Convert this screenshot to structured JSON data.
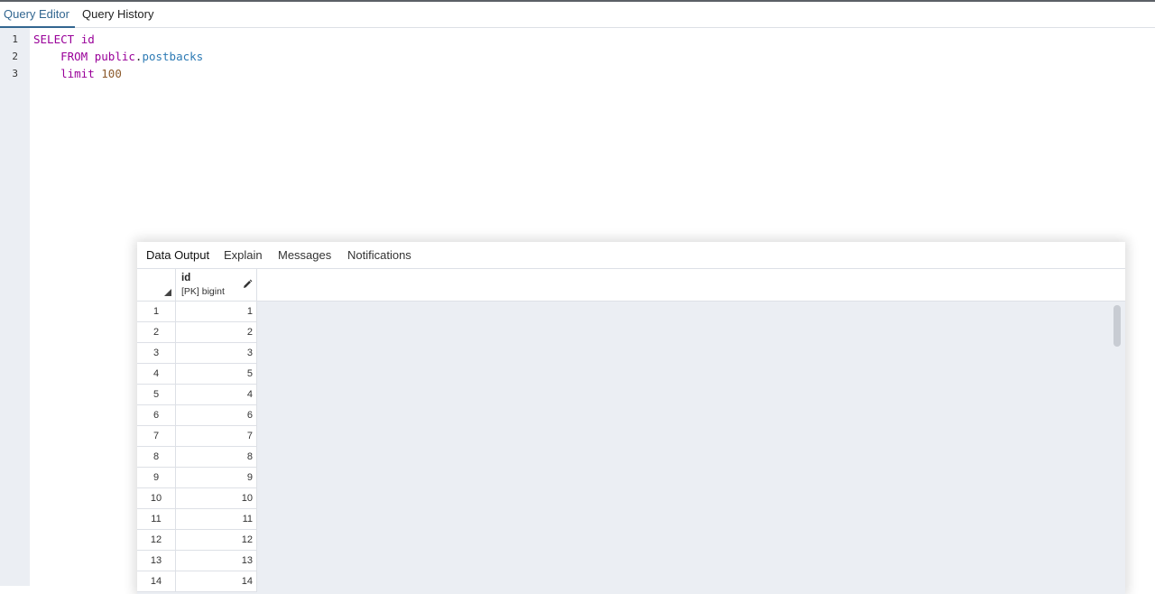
{
  "editor_tabs": [
    {
      "label": "Query Editor",
      "active": true
    },
    {
      "label": "Query History",
      "active": false
    }
  ],
  "line_numbers": [
    "1",
    "2",
    "3"
  ],
  "code": {
    "line1": {
      "kw": "SELECT",
      "ident": "id"
    },
    "line2": {
      "kw": "FROM",
      "schema": "public",
      "dot": ".",
      "table": "postbacks"
    },
    "line3": {
      "kw": "limit",
      "num": "100"
    }
  },
  "output_tabs": [
    {
      "label": "Data Output",
      "active": true
    },
    {
      "label": "Explain",
      "active": false
    },
    {
      "label": "Messages",
      "active": false
    },
    {
      "label": "Notifications",
      "active": false
    }
  ],
  "grid": {
    "column": {
      "name": "id",
      "type": "[PK] bigint"
    },
    "rows": [
      {
        "n": "1",
        "v": "1"
      },
      {
        "n": "2",
        "v": "2"
      },
      {
        "n": "3",
        "v": "3"
      },
      {
        "n": "4",
        "v": "5"
      },
      {
        "n": "5",
        "v": "4"
      },
      {
        "n": "6",
        "v": "6"
      },
      {
        "n": "7",
        "v": "7"
      },
      {
        "n": "8",
        "v": "8"
      },
      {
        "n": "9",
        "v": "9"
      },
      {
        "n": "10",
        "v": "10"
      },
      {
        "n": "11",
        "v": "11"
      },
      {
        "n": "12",
        "v": "12"
      },
      {
        "n": "13",
        "v": "13"
      },
      {
        "n": "14",
        "v": "14"
      }
    ]
  },
  "colors": {
    "accent": "#326690",
    "keyword": "#990099",
    "table": "#2e7bb5",
    "number": "#8c5a2b",
    "grid_bg": "#ebeef3"
  },
  "icons": {
    "edit_column": "pencil-icon",
    "select_all": "select-all-triangle-icon"
  }
}
